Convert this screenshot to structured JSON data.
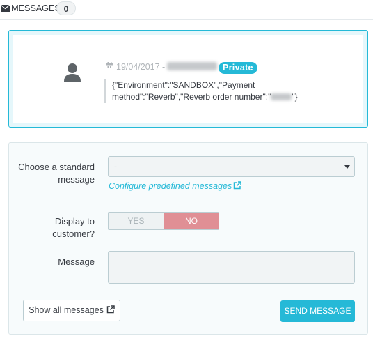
{
  "header": {
    "icon": "envelope-icon",
    "title": "MESSAGES",
    "count": "0"
  },
  "message": {
    "avatar_icon": "user-icon",
    "date_icon": "calendar-icon",
    "date": "19/04/2017 -",
    "visibility_badge": "Private",
    "body_prefix": "{\"Environment\":\"SANDBOX\",\"Payment method\":\"Reverb\",\"Reverb order number\":\"",
    "body_suffix": "\"}",
    "accent_color": "#25b9d7"
  },
  "form": {
    "standard_message_label": "Choose a standard message",
    "standard_message_value": "-",
    "configure_link": "Configure predefined messages",
    "display_label": "Display to customer?",
    "toggle_yes": "YES",
    "toggle_no": "NO",
    "toggle_selected": "NO",
    "message_label": "Message",
    "message_value": "",
    "show_all_button": "Show all messages",
    "send_button": "SEND MESSAGE",
    "send_color": "#25b9d7",
    "no_color": "#e08f95"
  }
}
